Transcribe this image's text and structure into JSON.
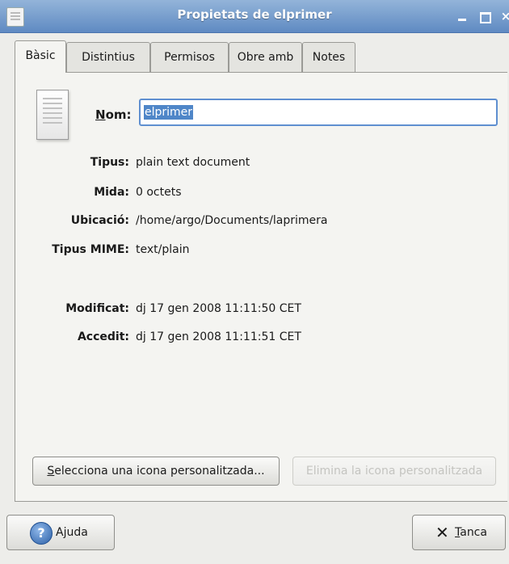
{
  "window": {
    "title": "Propietats de elprimer"
  },
  "tabs": [
    {
      "label": "Bàsic"
    },
    {
      "label": "Distintius"
    },
    {
      "label": "Permisos"
    },
    {
      "label": "Obre amb"
    },
    {
      "label": "Notes"
    }
  ],
  "file": {
    "icon": "text-document-icon",
    "name_label_mnemonic": "N",
    "name_label_rest": "om:",
    "name_value": "elprimer"
  },
  "properties": {
    "tipus": {
      "label": "Tipus:",
      "value": "plain text document"
    },
    "mida": {
      "label": "Mida:",
      "value": "0 octets"
    },
    "ubicacio": {
      "label": "Ubicació:",
      "value": "/home/argo/Documents/laprimera"
    },
    "mime": {
      "label": "Tipus MIME:",
      "value": "text/plain"
    },
    "modificat": {
      "label": "Modificat:",
      "value": "dj 17 gen 2008 11:11:50 CET"
    },
    "accedit": {
      "label": "Accedit:",
      "value": "dj 17 gen 2008 11:11:51 CET"
    }
  },
  "buttons": {
    "select_icon_mnemonic": "S",
    "select_icon_rest": "elecciona una icona personalitzada...",
    "remove_icon": "Elimina la icona personalitzada",
    "help": "Ajuda",
    "close_mnemonic": "T",
    "close_rest": "anca"
  },
  "icons": {
    "help": "help-icon",
    "close": "close-icon",
    "window_close": "close-icon",
    "window_minimize": "minimize-icon",
    "window_maximize": "maximize-icon"
  },
  "colors": {
    "titlebar": "#6f98cc",
    "selection": "#4f86c8",
    "focus_border": "#5f8fd0"
  }
}
